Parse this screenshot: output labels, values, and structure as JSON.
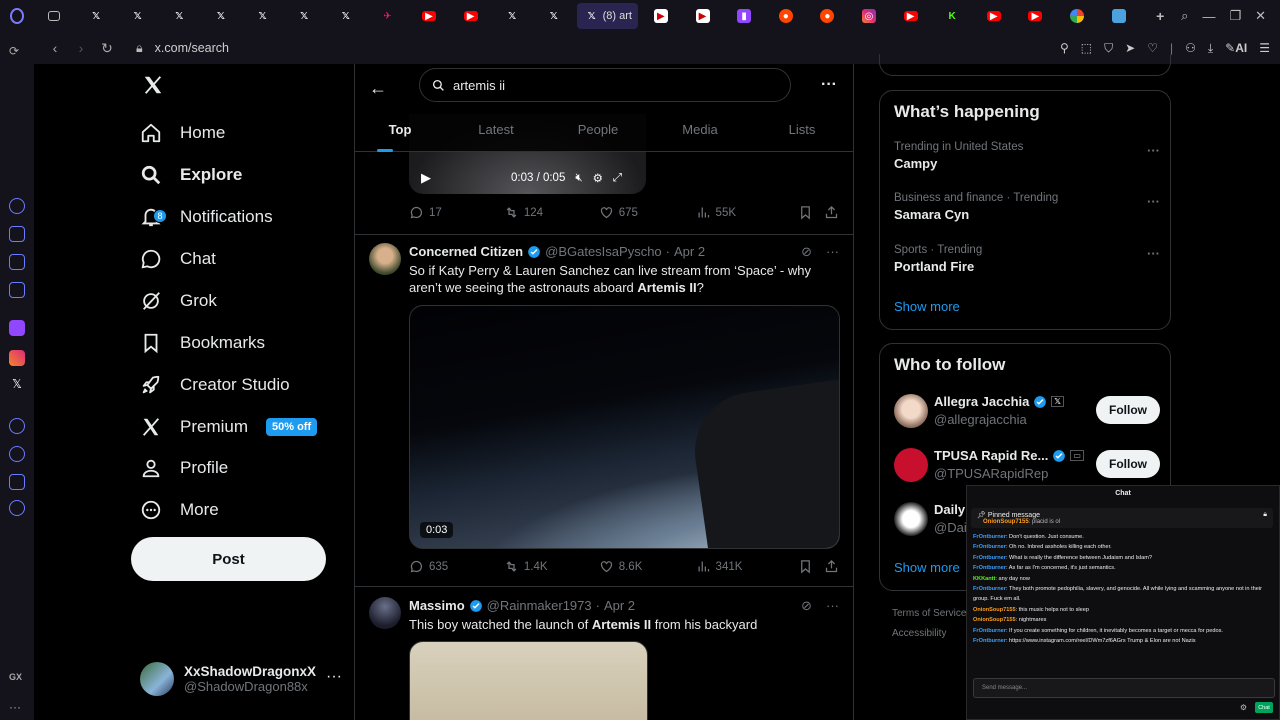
{
  "browser": {
    "active_tab_title": "(8) art",
    "url": "x.com/search",
    "ai_label": "AI"
  },
  "nav": {
    "items": [
      {
        "label": "Home",
        "icon": "home-icon"
      },
      {
        "label": "Explore",
        "icon": "search-icon"
      },
      {
        "label": "Notifications",
        "icon": "bell-icon",
        "badge": "8"
      },
      {
        "label": "Chat",
        "icon": "chat-icon"
      },
      {
        "label": "Grok",
        "icon": "grok-icon"
      },
      {
        "label": "Bookmarks",
        "icon": "bookmark-icon"
      },
      {
        "label": "Creator Studio",
        "icon": "rocket-icon"
      },
      {
        "label": "Premium",
        "icon": "x-icon",
        "badge": "50% off"
      },
      {
        "label": "Profile",
        "icon": "person-icon"
      },
      {
        "label": "More",
        "icon": "more-circle-icon"
      }
    ],
    "post_label": "Post",
    "account": {
      "name": "XxShadowDragonxX",
      "handle": "@ShadowDragon88x"
    }
  },
  "search": {
    "query": "artemis ii",
    "tabs": [
      "Top",
      "Latest",
      "People",
      "Media",
      "Lists"
    ],
    "active_tab": "Top"
  },
  "prev_tweet": {
    "video_time": "0:03 / 0:05",
    "replies": "17",
    "reposts": "124",
    "likes": "675",
    "views": "55K"
  },
  "tweets": [
    {
      "name": "Concerned Citizen",
      "handle": "@BGatesIsaPyscho",
      "date": "Apr 2",
      "text_before": "So if Katy Perry & Lauren Sanchez can live stream from ‘Space’ - why aren’t we seeing the astronauts aboard ",
      "text_bold": "Artemis II",
      "text_after": "?",
      "video_time": "0:03",
      "replies": "635",
      "reposts": "1.4K",
      "likes": "8.6K",
      "views": "341K"
    },
    {
      "name": "Massimo",
      "handle": "@Rainmaker1973",
      "date": "Apr 2",
      "text_before": "This boy watched the launch of ",
      "text_bold": "Artemis II",
      "text_after": " from his backyard"
    }
  ],
  "happening": {
    "title": "What’s happening",
    "trends": [
      {
        "category": "Trending in United States",
        "name": "Campy"
      },
      {
        "category": "Business and finance · Trending",
        "name": "Samara Cyn"
      },
      {
        "category": "Sports · Trending",
        "name": "Portland Fire"
      }
    ],
    "show_more": "Show more"
  },
  "who_to_follow": {
    "title": "Who to follow",
    "accounts": [
      {
        "name": "Allegra Jacchia",
        "handle": "@allegrajacchia",
        "button": "Follow"
      },
      {
        "name": "TPUSA Rapid Re...",
        "handle": "@TPUSARapidRep",
        "button": "Follow"
      },
      {
        "name": "Daily",
        "handle": "@Dail"
      }
    ],
    "show_more": "Show more"
  },
  "footer": {
    "terms": "Terms of Service",
    "accessibility": "Accessibility"
  },
  "chat": {
    "title": "Chat",
    "pinned_label": "Pinned message",
    "pinned_user": "OnionSoup7155",
    "pinned_text": ": placid is ol",
    "messages": [
      {
        "user": "FrOntburner",
        "text": ": Don't question. Just consume."
      },
      {
        "user": "FrOntburner",
        "text": ": Oh no. Inbred assholes killing each other."
      },
      {
        "user": "FrOntburner",
        "text": ": What is really the difference between Judaism and Islam?"
      },
      {
        "user": "FrOntburner",
        "text": ": As far as I'm concerned, it's just semantics."
      },
      {
        "user": "KKKantt",
        "text": ": any day now"
      },
      {
        "user": "FrOntburner",
        "text": ": They both promote pedophilia, slavery, and genocide. All while lying and scamming anyone not in their group. Fuck em all."
      },
      {
        "user": "OnionSoup7155",
        "text": ": this music helps not to sleep"
      },
      {
        "user": "OnionSoup7155",
        "text": ": nightmares"
      },
      {
        "user": "FrOntburner",
        "text": ": If you create something for children, it inevitably becomes a target or mecca for pedos."
      },
      {
        "user": "FrOntburner",
        "text": ": https://www.instagram.com/reel/DWm7zf6AGrs Trump & Elon are not Nazis"
      }
    ],
    "input_placeholder": "Send message...",
    "send_label": "Chat"
  },
  "colors": {
    "accent": "#1d9bf0",
    "bg": "#000000",
    "border": "#2f3336",
    "muted": "#71767b"
  }
}
